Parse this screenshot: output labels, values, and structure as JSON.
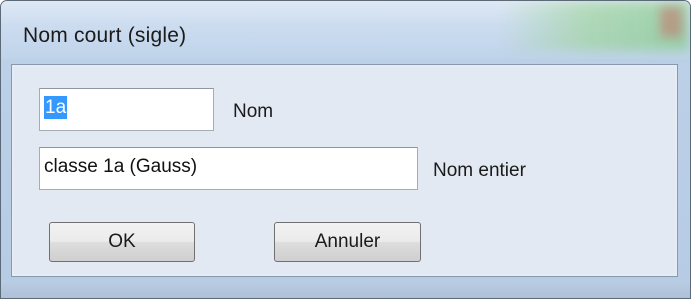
{
  "window": {
    "title": "Nom court (sigle)"
  },
  "form": {
    "short_name": {
      "value": "1a",
      "label": "Nom"
    },
    "full_name": {
      "value": "classe 1a (Gauss)",
      "label": "Nom entier"
    }
  },
  "buttons": {
    "ok_label": "OK",
    "cancel_label": "Annuler"
  },
  "colors": {
    "selection": "#3399ff",
    "title_bar": "#cdddf0",
    "client_bg": "#e3e9f3"
  }
}
